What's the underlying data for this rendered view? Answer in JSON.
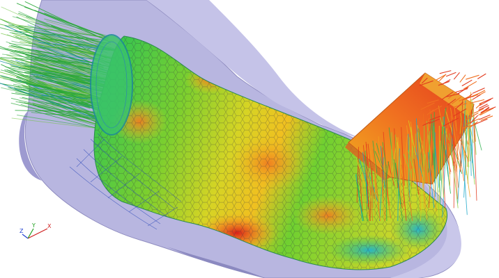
{
  "viewport": {
    "background": "#ffffff",
    "mesh_color": "#3a3a5a",
    "housing_color": "#b4b2dc",
    "colormap": [
      "#1aa7c9",
      "#22c25a",
      "#9fd62a",
      "#f0d020",
      "#f29a22",
      "#e23a1e"
    ]
  },
  "axes": {
    "x": "X",
    "y": "Y",
    "z": "Z",
    "x_color": "#d02020",
    "y_color": "#20a020",
    "z_color": "#2040d0"
  }
}
